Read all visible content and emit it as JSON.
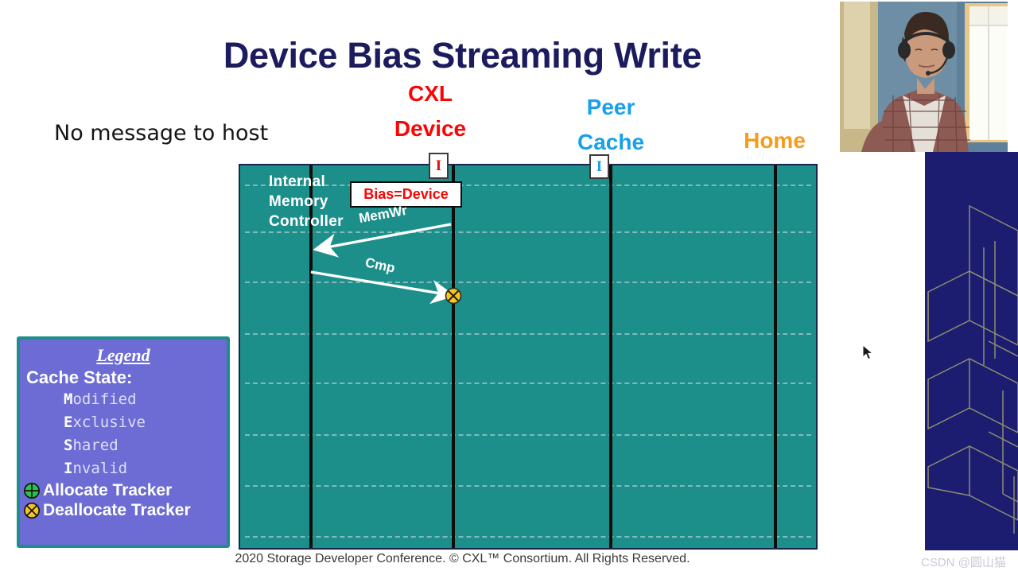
{
  "slide": {
    "title": "Device Bias Streaming Write",
    "note": "No message to host",
    "footer": "2020 Storage Developer Conference. © CXL™ Consortium.  All Rights Reserved."
  },
  "columns": [
    {
      "id": "cxl-device",
      "label": "CXL\nDevice",
      "line1": "CXL",
      "line2": "Device",
      "color": "#fb0404"
    },
    {
      "id": "peer-cache",
      "label": "Peer\nCache",
      "line1": "Peer",
      "line2": "Cache",
      "color": "#18a0e8"
    },
    {
      "id": "home",
      "label": "Home",
      "line1": "Home",
      "line2": "",
      "color": "#f79b1b"
    }
  ],
  "diagram": {
    "internal_controller_label": "Internal\nMemory\nController",
    "internal_controller_lines": [
      "Internal",
      "Memory",
      "Controller"
    ],
    "bias_box": "Bias=Device",
    "background_color": "#1d8f8b",
    "states": [
      {
        "owner": "cxl-device",
        "value": "I",
        "color": "#e01010"
      },
      {
        "owner": "peer-cache",
        "value": "I",
        "color": "#18a0e8"
      }
    ],
    "messages": [
      {
        "label": "MemWr",
        "from": "cxl-device",
        "to": "internal-memory-controller",
        "direction": "left"
      },
      {
        "label": "Cmp",
        "from": "internal-memory-controller",
        "to": "cxl-device",
        "direction": "right"
      }
    ],
    "markers": [
      {
        "type": "deallocate-tracker",
        "owner": "cxl-device"
      }
    ]
  },
  "legend": {
    "title": "Legend",
    "subtitle": "Cache State:",
    "states": [
      {
        "initial": "M",
        "rest": "odified"
      },
      {
        "initial": "E",
        "rest": "xclusive"
      },
      {
        "initial": "S",
        "rest": "hared"
      },
      {
        "initial": "I",
        "rest": "nvalid"
      }
    ],
    "trackers": [
      {
        "glyph": "allocate-tracker-icon",
        "label": "Allocate Tracker",
        "color": "#2cc04a"
      },
      {
        "glyph": "deallocate-tracker-icon",
        "label": "Deallocate Tracker",
        "color": "#f5c51b"
      }
    ]
  },
  "watermark": "CSDN @圆山猫",
  "colors": {
    "title": "#1b1b5e",
    "diagram_teal": "#1d8f8b",
    "legend_fill": "#6c6cd4",
    "side_panel": "#1c1c70"
  }
}
